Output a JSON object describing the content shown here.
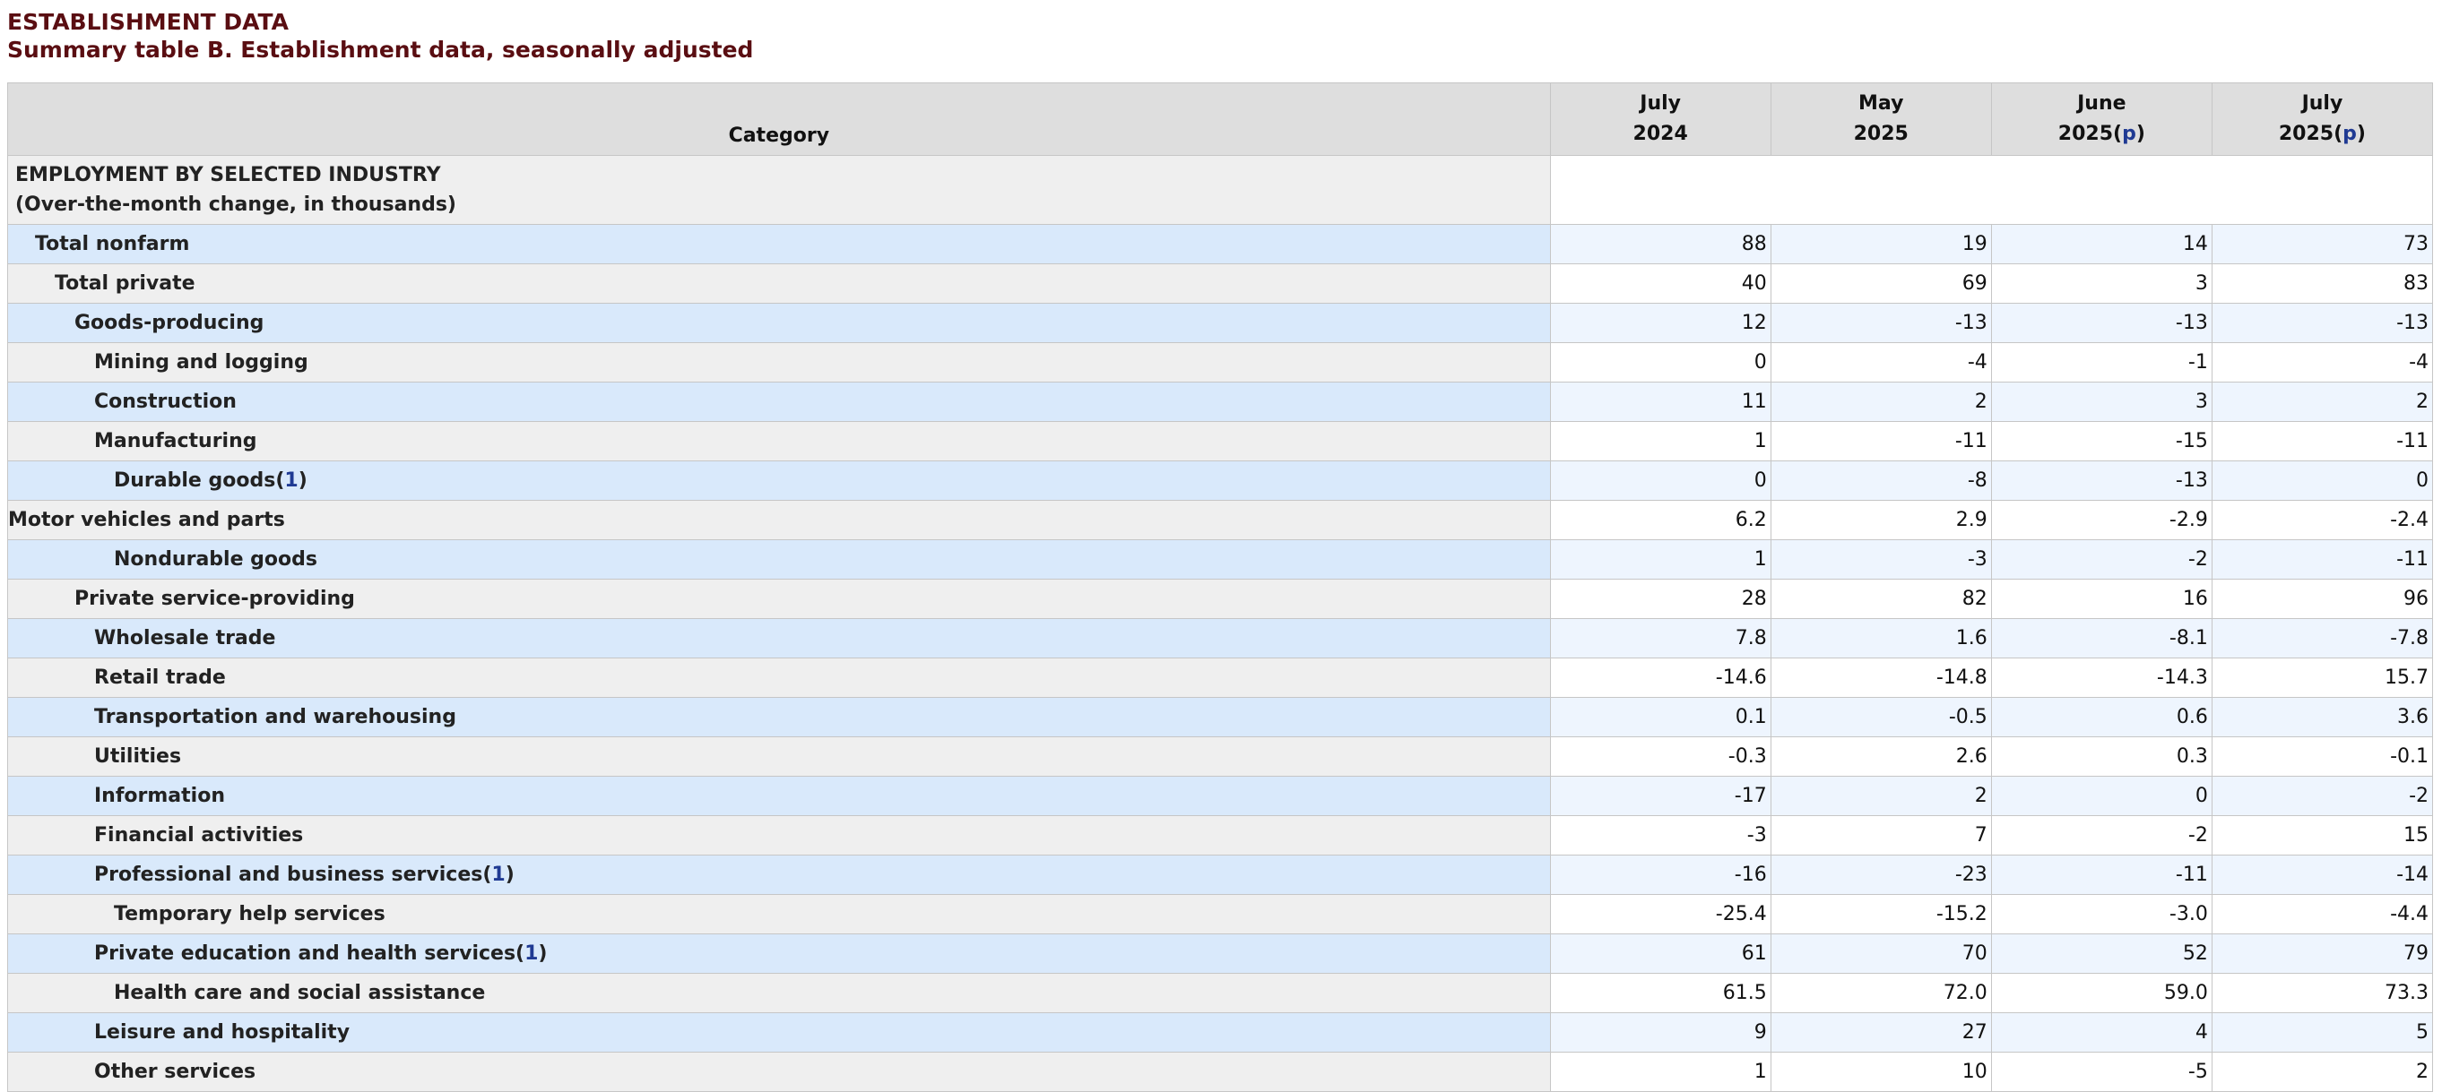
{
  "header": {
    "title": "ESTABLISHMENT DATA",
    "subtitle": "Summary table B. Establishment data, seasonally adjusted"
  },
  "table": {
    "category_header": "Category",
    "columns": [
      {
        "month": "July",
        "year": "2024",
        "prelim": ""
      },
      {
        "month": "May",
        "year": "2025",
        "prelim": ""
      },
      {
        "month": "June",
        "year": "2025",
        "prelim": "p"
      },
      {
        "month": "July",
        "year": "2025",
        "prelim": "p"
      }
    ],
    "section": {
      "line1": "EMPLOYMENT BY SELECTED INDUSTRY",
      "line2": "(Over-the-month change, in thousands)"
    },
    "rows": [
      {
        "label": "Total nonfarm",
        "footnote": "",
        "values": [
          "88",
          "19",
          "14",
          "73"
        ]
      },
      {
        "label": "Total private",
        "footnote": "",
        "values": [
          "40",
          "69",
          "3",
          "83"
        ]
      },
      {
        "label": "Goods-producing",
        "footnote": "",
        "values": [
          "12",
          "-13",
          "-13",
          "-13"
        ]
      },
      {
        "label": "Mining and logging",
        "footnote": "",
        "values": [
          "0",
          "-4",
          "-1",
          "-4"
        ]
      },
      {
        "label": "Construction",
        "footnote": "",
        "values": [
          "11",
          "2",
          "3",
          "2"
        ]
      },
      {
        "label": "Manufacturing",
        "footnote": "",
        "values": [
          "1",
          "-11",
          "-15",
          "-11"
        ]
      },
      {
        "label": "Durable goods",
        "footnote": "1",
        "values": [
          "0",
          "-8",
          "-13",
          "0"
        ]
      },
      {
        "label": "Motor vehicles and parts",
        "footnote": "",
        "values": [
          "6.2",
          "2.9",
          "-2.9",
          "-2.4"
        ]
      },
      {
        "label": "Nondurable goods",
        "footnote": "",
        "values": [
          "1",
          "-3",
          "-2",
          "-11"
        ]
      },
      {
        "label": "Private service-providing",
        "footnote": "",
        "values": [
          "28",
          "82",
          "16",
          "96"
        ]
      },
      {
        "label": "Wholesale trade",
        "footnote": "",
        "values": [
          "7.8",
          "1.6",
          "-8.1",
          "-7.8"
        ]
      },
      {
        "label": "Retail trade",
        "footnote": "",
        "values": [
          "-14.6",
          "-14.8",
          "-14.3",
          "15.7"
        ]
      },
      {
        "label": "Transportation and warehousing",
        "footnote": "",
        "values": [
          "0.1",
          "-0.5",
          "0.6",
          "3.6"
        ]
      },
      {
        "label": "Utilities",
        "footnote": "",
        "values": [
          "-0.3",
          "2.6",
          "0.3",
          "-0.1"
        ]
      },
      {
        "label": "Information",
        "footnote": "",
        "values": [
          "-17",
          "2",
          "0",
          "-2"
        ]
      },
      {
        "label": "Financial activities",
        "footnote": "",
        "values": [
          "-3",
          "7",
          "-2",
          "15"
        ]
      },
      {
        "label": "Professional and business services",
        "footnote": "1",
        "values": [
          "-16",
          "-23",
          "-11",
          "-14"
        ]
      },
      {
        "label": "Temporary help services",
        "footnote": "",
        "values": [
          "-25.4",
          "-15.2",
          "-3.0",
          "-4.4"
        ]
      },
      {
        "label": "Private education and health services",
        "footnote": "1",
        "values": [
          "61",
          "70",
          "52",
          "79"
        ]
      },
      {
        "label": "Health care and social assistance",
        "footnote": "",
        "values": [
          "61.5",
          "72.0",
          "59.0",
          "73.3"
        ]
      },
      {
        "label": "Leisure and hospitality",
        "footnote": "",
        "values": [
          "9",
          "27",
          "4",
          "5"
        ]
      },
      {
        "label": "Other services",
        "footnote": "",
        "values": [
          "1",
          "10",
          "-5",
          "2"
        ]
      }
    ]
  }
}
